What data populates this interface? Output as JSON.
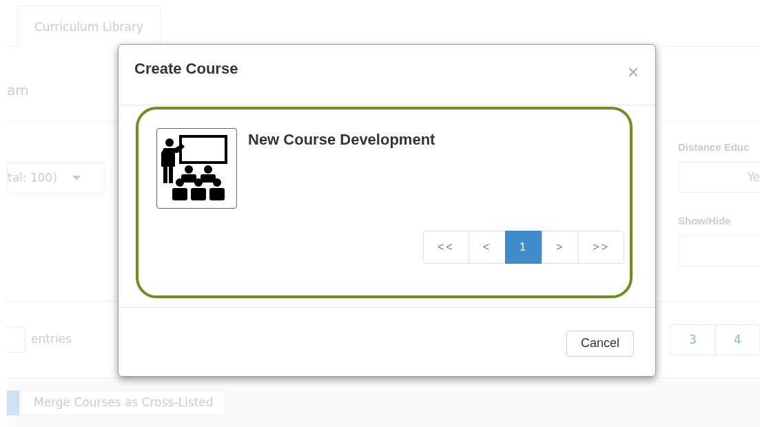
{
  "background_page": {
    "tabs": [
      {
        "label": "Curriculum Library",
        "selected": true
      }
    ],
    "heading_fragment": "am",
    "filter_select": {
      "value": "tal: 100)"
    },
    "filters": [
      {
        "label": "Distance Educ",
        "value": "Ye"
      },
      {
        "label": "Show/Hide"
      }
    ],
    "entries_label": "entries",
    "pagination": [
      {
        "label": "3",
        "selected": false
      },
      {
        "label": "4",
        "selected": false
      }
    ],
    "action_buttons": [
      "Merge Courses as Cross-Listed"
    ]
  },
  "modal": {
    "title": "Create Course",
    "close": "×",
    "options": [
      {
        "title": "New Course Development"
      }
    ],
    "pagination": [
      {
        "label": "<<",
        "selected": false
      },
      {
        "label": "<",
        "selected": false
      },
      {
        "label": "1",
        "selected": true
      },
      {
        "label": ">",
        "selected": false
      },
      {
        "label": ">>",
        "selected": false
      }
    ],
    "buttons": [
      "Cancel"
    ]
  }
}
